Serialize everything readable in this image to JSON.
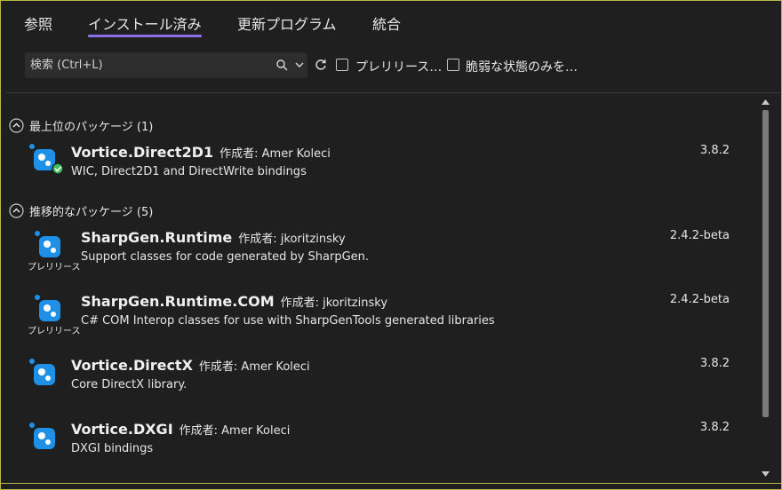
{
  "tabs": [
    {
      "label": "参照",
      "selected": false
    },
    {
      "label": "インストール済み",
      "selected": true
    },
    {
      "label": "更新プログラム",
      "selected": false
    },
    {
      "label": "統合",
      "selected": false
    }
  ],
  "colors": {
    "accent": "#8c6ee6",
    "frame": "#b9b94a",
    "icon_blue": "#1e90e8",
    "badge_green": "#3fbf5f"
  },
  "search": {
    "placeholder": "検索 (Ctrl+L)",
    "value": ""
  },
  "filters": {
    "prerelease_label": "プレリリース…",
    "prerelease_checked": false,
    "vulnerable_label": "脆弱な状態のみを…",
    "vulnerable_checked": false
  },
  "groups": {
    "top_level": {
      "label": "最上位のパッケージ (1)"
    },
    "transitive": {
      "label": "推移的なパッケージ (5)"
    }
  },
  "packages": [
    {
      "name": "Vortice.Direct2D1",
      "by": "作成者: Amer Koleci",
      "description": "WIC, Direct2D1 and DirectWrite bindings",
      "version": "3.8.2",
      "prerelease_tag": "",
      "installed_badge": true
    },
    {
      "name": "SharpGen.Runtime",
      "by": "作成者: jkoritzinsky",
      "description": "Support classes for code generated by SharpGen.",
      "version": "2.4.2-beta",
      "prerelease_tag": "プレリリース",
      "installed_badge": false
    },
    {
      "name": "SharpGen.Runtime.COM",
      "by": "作成者: jkoritzinsky",
      "description": "C# COM Interop classes for use with SharpGenTools generated libraries",
      "version": "2.4.2-beta",
      "prerelease_tag": "プレリリース",
      "installed_badge": false
    },
    {
      "name": "Vortice.DirectX",
      "by": "作成者: Amer Koleci",
      "description": "Core DirectX library.",
      "version": "3.8.2",
      "prerelease_tag": "",
      "installed_badge": false
    },
    {
      "name": "Vortice.DXGI",
      "by": "作成者: Amer Koleci",
      "description": "DXGI bindings",
      "version": "3.8.2",
      "prerelease_tag": "",
      "installed_badge": false
    }
  ]
}
